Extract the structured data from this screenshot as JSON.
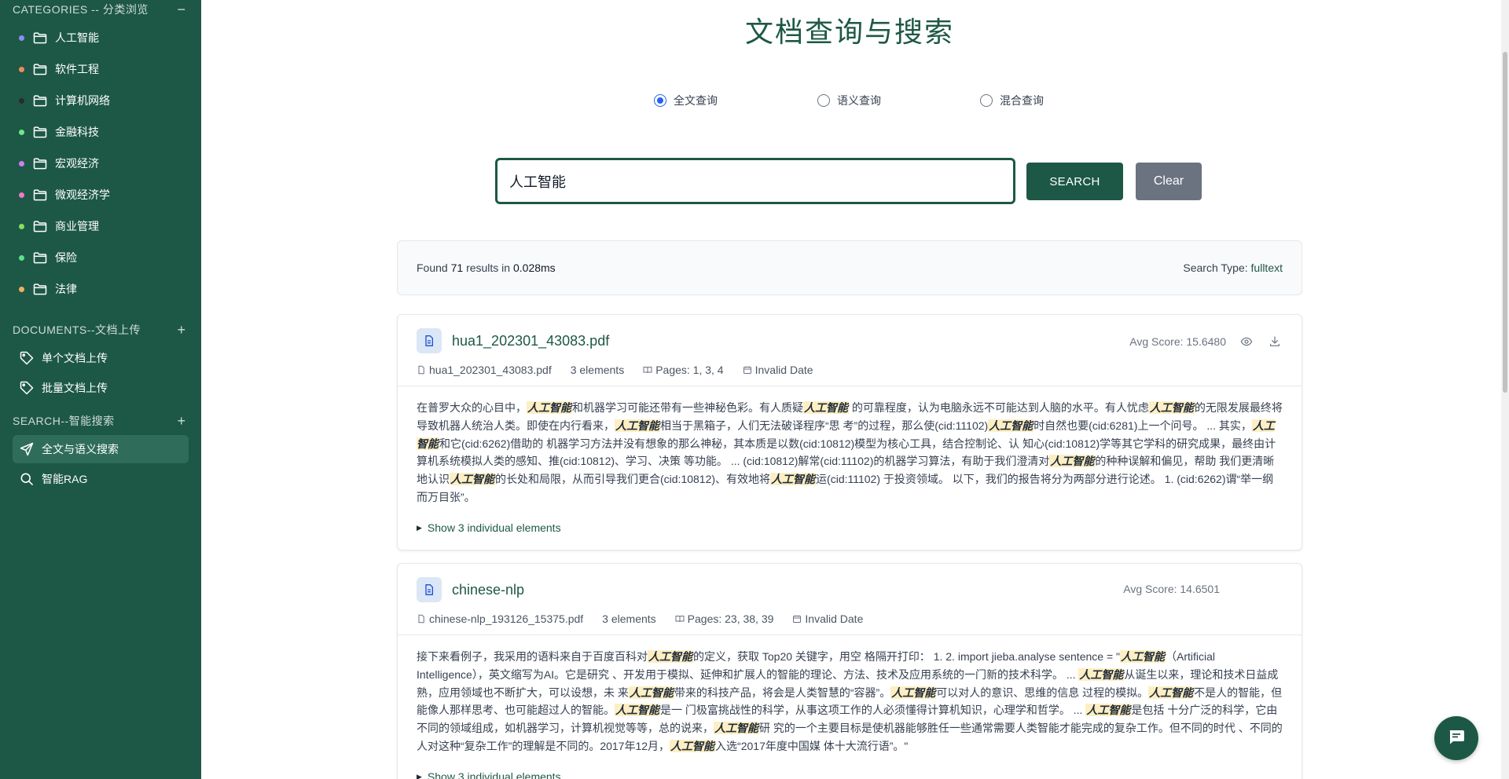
{
  "sidebar": {
    "categories_header": "CATEGORIES -- 分类浏览",
    "categories_action": "−",
    "categories": [
      {
        "label": "人工智能",
        "dot": "#8b8ef0"
      },
      {
        "label": "软件工程",
        "dot": "#f08a5d"
      },
      {
        "label": "计算机网络",
        "dot": "#2b2b2b"
      },
      {
        "label": "金融科技",
        "dot": "#6ee78a"
      },
      {
        "label": "宏观经济",
        "dot": "#d07ef0"
      },
      {
        "label": "微观经济学",
        "dot": "#f07ac0"
      },
      {
        "label": "商业管理",
        "dot": "#86e05a"
      },
      {
        "label": "保险",
        "dot": "#5de08a"
      },
      {
        "label": "法律",
        "dot": "#f0b05d"
      }
    ],
    "documents_header": "DOCUMENTS--文档上传",
    "documents_action": "+",
    "documents": [
      "单个文档上传",
      "批量文档上传"
    ],
    "search_header": "SEARCH--智能搜索",
    "search_action": "+",
    "search_items": [
      "全文与语义搜索",
      "智能RAG"
    ]
  },
  "main": {
    "title": "文档查询与搜索",
    "modes": [
      "全文查询",
      "语义查询",
      "混合查询"
    ],
    "selected_mode": "全文查询",
    "query": "人工智能",
    "search_button": "SEARCH",
    "clear_button": "Clear",
    "summary": {
      "found_label": "Found",
      "count": "71",
      "results_in_label": "results in",
      "time": "0.028ms",
      "type_label": "Search Type:",
      "type_value": "fulltext"
    },
    "results": [
      {
        "title": "hua1_202301_43083.pdf",
        "score": "Avg Score: 15.6480",
        "filename": "hua1_202301_43083.pdf",
        "elements": "3 elements",
        "pages": "Pages: 1, 3, 4",
        "date": "Invalid Date",
        "show_more": "Show 3 individual elements",
        "segments": [
          {
            "t": "在普罗大众的心目中，",
            "h": false
          },
          {
            "t": "人工智能",
            "h": true
          },
          {
            "t": "和机器学习可能还带有一些神秘色彩。有人质疑",
            "h": false
          },
          {
            "t": "人工智能",
            "h": true
          },
          {
            "t": " 的可靠程度，认为电脑永远不可能达到人脑的水平。有人忧虑",
            "h": false
          },
          {
            "t": "人工智能",
            "h": true
          },
          {
            "t": "的无限发展最终将导致机器人统治人类。即使在内行看来，",
            "h": false
          },
          {
            "t": "人工智能",
            "h": true
          },
          {
            "t": "相当于黑箱子，人们无法破译程序“思 考”的过程，那么使(cid:11102)",
            "h": false
          },
          {
            "t": "人工智能",
            "h": true
          },
          {
            "t": "时自然也要(cid:6281)上一个问号。 ... 其实，",
            "h": false
          },
          {
            "t": "人工智能",
            "h": true
          },
          {
            "t": "和它(cid:6262)借助的 机器学习方法并没有想象的那么神秘，其本质是以数(cid:10812)模型为核心工具，结合控制论、认 知心(cid:10812)学等其它学科的研究成果，最终由计算机系统模拟人类的感知、推(cid:10812)、学习、决策 等功能。 ... (cid:10812)解常(cid:11102)的机器学习算法，有助于我们澄清对",
            "h": false
          },
          {
            "t": "人工智能",
            "h": true
          },
          {
            "t": "的种种误解和偏见，帮助 我们更清晰地认识",
            "h": false
          },
          {
            "t": "人工智能",
            "h": true
          },
          {
            "t": "的长处和局限，从而引导我们更合(cid:10812)、有效地将",
            "h": false
          },
          {
            "t": "人工智能",
            "h": true
          },
          {
            "t": "运(cid:11102) 于投资领域。 以下，我们的报告将分为两部分进行论述。 1. (cid:6262)谓“举一纲而万目张”。",
            "h": false
          }
        ]
      },
      {
        "title": "chinese-nlp",
        "score": "Avg Score: 14.6501",
        "filename": "chinese-nlp_193126_15375.pdf",
        "elements": "3 elements",
        "pages": "Pages: 23, 38, 39",
        "date": "Invalid Date",
        "show_more": "Show 3 individual elements",
        "segments": [
          {
            "t": "接下来看例子，我采用的语料来自于百度百科对",
            "h": false
          },
          {
            "t": "人工智能",
            "h": true
          },
          {
            "t": "的定义，获取 Top20 关键字，用空 格隔开打印： 1. 2. import jieba.analyse sentence = \"",
            "h": false
          },
          {
            "t": "人工智能",
            "h": true
          },
          {
            "t": "（Artificial Intelligence），英文缩写为AI。它是研究 、开发用于模拟、延伸和扩展人的智能的理论、方法、技术及应用系统的一门新的技术科学。 ... ",
            "h": false
          },
          {
            "t": "人工智能",
            "h": true
          },
          {
            "t": "从诞生以来，理论和技术日益成熟，应用领域也不断扩大，可以设想，未 来",
            "h": false
          },
          {
            "t": "人工智能",
            "h": true
          },
          {
            "t": "带来的科技产品，将会是人类智慧的“容器”。",
            "h": false
          },
          {
            "t": "人工智能",
            "h": true
          },
          {
            "t": "可以对人的意识、思维的信息 过程的模拟。",
            "h": false
          },
          {
            "t": "人工智能",
            "h": true
          },
          {
            "t": "不是人的智能，但能像人那样思考、也可能超过人的智能。",
            "h": false
          },
          {
            "t": "人工智能",
            "h": true
          },
          {
            "t": "是一 门极富挑战性的科学，从事这项工作的人必须懂得计算机知识，心理学和哲学。 ... ",
            "h": false
          },
          {
            "t": "人工智能",
            "h": true
          },
          {
            "t": "是包括 十分广泛的科学，它由不同的领域组成，如机器学习，计算机视觉等等，总的说来，",
            "h": false
          },
          {
            "t": "人工智能",
            "h": true
          },
          {
            "t": "研 究的一个主要目标是使机器能够胜任一些通常需要人类智能才能完成的复杂工作。但不同的时代 、不同的人对这种“复杂工作”的理解是不同的。2017年12月，",
            "h": false
          },
          {
            "t": "人工智能",
            "h": true
          },
          {
            "t": "入选“2017年度中国媒 体十大流行语”。\"",
            "h": false
          }
        ]
      }
    ]
  },
  "colors": {
    "sidebar_bg": "#1d5846",
    "accent": "#1d5846",
    "clear_button": "#6b7280",
    "highlight": "#fdefc3",
    "radio_selected": "#2563eb"
  },
  "icons": {
    "category": "folder-icon",
    "upload": "tag-icon",
    "search_nav": "send-icon",
    "rag_nav": "magnifier-icon",
    "document": "document-icon",
    "preview": "eye-icon",
    "download": "download-icon",
    "chat": "chat-icon"
  }
}
